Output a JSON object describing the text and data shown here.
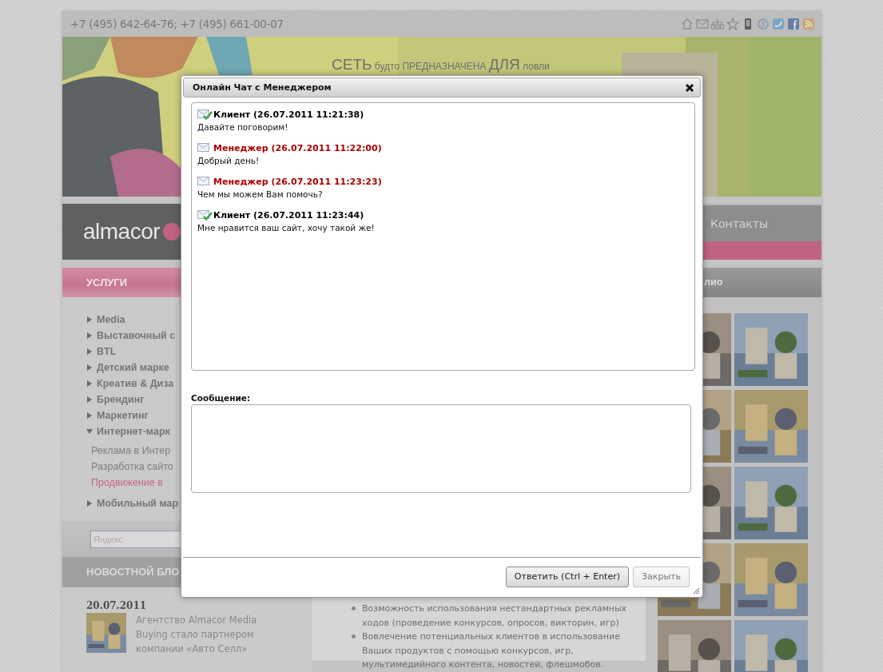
{
  "top_bar": {
    "phone": "+7 (495) 642-64-76; +7 (495) 661-00-07"
  },
  "banner": {
    "tagline": [
      {
        "text": "СЕТЬ",
        "large": true
      },
      {
        "text": "будто ПРЕДНАЗНАЧЕНА",
        "large": false
      },
      {
        "text": "ДЛЯ",
        "large": true
      },
      {
        "text": "ловли",
        "large": false
      }
    ]
  },
  "nav": {
    "logo": "almacor",
    "links": [
      {
        "label": "Контакты"
      }
    ]
  },
  "services": {
    "title": "УСЛУГИ",
    "items": [
      {
        "label": "Media",
        "expanded": false
      },
      {
        "label": "Выставочный с",
        "expanded": false
      },
      {
        "label": "BTL",
        "expanded": false
      },
      {
        "label": "Детский марке",
        "expanded": false
      },
      {
        "label": "Креатив & Диза",
        "expanded": false
      },
      {
        "label": "Брендинг",
        "expanded": false
      },
      {
        "label": "Маркетинг",
        "expanded": false
      },
      {
        "label": "Интернет-марк",
        "expanded": true,
        "children": [
          {
            "label": "Реклама в Интер",
            "selected": false
          },
          {
            "label": "Разработка сайто",
            "selected": false
          },
          {
            "label": "Продвижение в",
            "selected": true
          }
        ]
      },
      {
        "label": "Мобильный мар",
        "expanded": false
      }
    ]
  },
  "search": {
    "placeholder": "Яндекс"
  },
  "news": {
    "title": "НОВОСТНОЙ БЛО",
    "items": [
      {
        "date": "20.07.2011",
        "text": "Агентство Almacor Media Buying стало партнером компании «Авто Селл»"
      }
    ]
  },
  "content": {
    "bullets": [
      "Возможность использования нестандартных рекламных ходов (проведение конкурсов, опросов, викторин, игр)",
      "Вовлечение потенциальных клиентов в использование Ваших продуктов с помощью конкурсов, игр, мультимедийного контента, новостей, флешмобов."
    ]
  },
  "portfolio": {
    "title": "лио"
  },
  "dialog": {
    "title": "Онлайн Чат с Менеджером",
    "messages": [
      {
        "kind": "client",
        "header": "Клиент (26.07.2011 11:21:38)",
        "text": "Давайте поговорим!"
      },
      {
        "kind": "manager",
        "header": "Менеджер (26.07.2011 11:22:00)",
        "text": "Добрый день!"
      },
      {
        "kind": "manager",
        "header": "Менеджер (26.07.2011 11:23:23)",
        "text": "Чем мы можем Вам помочь?"
      },
      {
        "kind": "client",
        "header": "Клиент (26.07.2011 11:23:44)",
        "text": "Мне нравится ваш сайт, хочу такой же!"
      }
    ],
    "message_label": "Сообщение:",
    "buttons": [
      {
        "label": "Ответить (Ctrl + Enter)",
        "kind": "primary"
      },
      {
        "label": "Закрыть",
        "kind": "secondary"
      }
    ]
  }
}
